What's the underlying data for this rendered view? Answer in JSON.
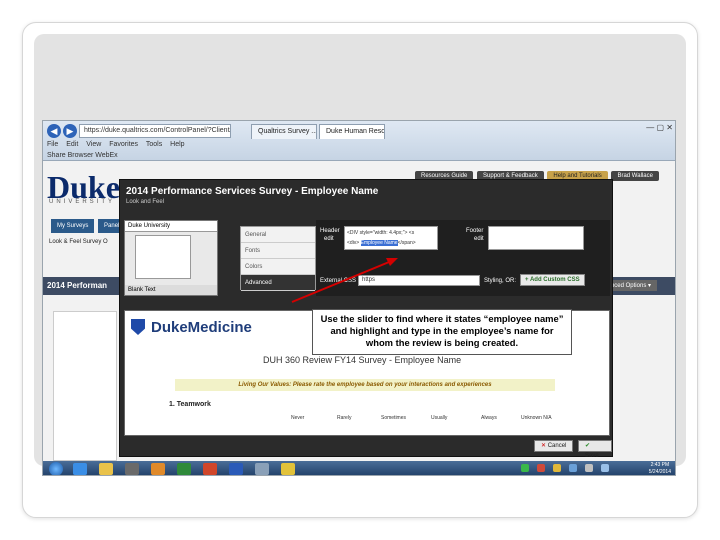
{
  "browser": {
    "address": "https://duke.qualtrics.com/ControlPanel/?ClientAction",
    "tabs": [
      "Qualtrics Survey ...",
      "Duke Human Reso..."
    ],
    "menu": [
      "File",
      "Edit",
      "View",
      "Favorites",
      "Tools",
      "Help"
    ],
    "favorites": "Share Browser  WebEx"
  },
  "page": {
    "logo": "Duke",
    "logo_sub": "UNIVERSITY",
    "top_links": [
      "Resources Guide",
      "Support & Feedback",
      "Help and Tutorials",
      "Brad Wallace"
    ],
    "tabs": [
      "My Surveys",
      "Panels"
    ],
    "tools": [
      "Look & Feel",
      "Survey O"
    ],
    "banner": "2014 Performan",
    "right_options": "Advanced Options ▾"
  },
  "modal": {
    "title": "2014 Performance Services Survey - Employee Name",
    "subtitle": "Look and Feel",
    "theme": {
      "name": "Duke University",
      "footer": "Blank Text"
    },
    "menu": [
      "General",
      "Fonts",
      "Colors",
      "Advanced"
    ],
    "header_label": "Header",
    "header_edit": "edit",
    "header_code_1": "<DIV style=\"width: 4.4px;\"> <s",
    "header_code_pre": "<div> ",
    "header_code_hl": "Employee Name",
    "header_code_post": "</span>",
    "footer_label": "Footer",
    "footer_edit": "edit",
    "external_css_label": "External CSS",
    "external_css_value": "https",
    "external_css_after": "Styling, OR:",
    "add_css_button": "Add Custom CSS",
    "preview": {
      "brand": "DukeMedicine",
      "survey_name": "DUH 360 Review FY14 Survey - Employee Name",
      "living": "Living Our Values: Please rate the employee based on your interactions and experiences",
      "question": "1. Teamwork",
      "scale": [
        "Never",
        "Rarely",
        "Sometimes",
        "Usually",
        "Always",
        "Unknown N/A"
      ]
    },
    "cancel_button": "Cancel",
    "save_button": "Save"
  },
  "callout": "Use the slider to find where it states “employee name” and highlight and type in the employee’s name for whom the review is being created.",
  "taskbar": {
    "time": "2:43 PM",
    "date": "5/24/2014"
  },
  "colors": {
    "duke_blue": "#0b2a6b",
    "modal_bg": "#2b2b2b",
    "highlight": "#3b6fd4",
    "arrow": "#d40000"
  }
}
